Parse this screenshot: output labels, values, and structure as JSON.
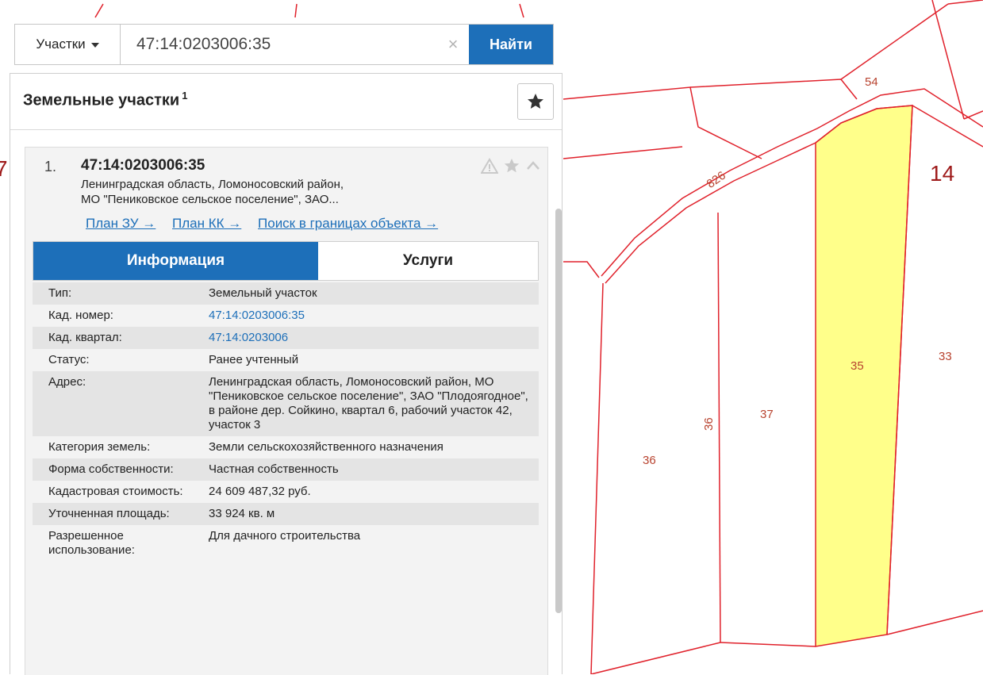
{
  "search": {
    "type_label": "Участки",
    "query": "47:14:0203006:35",
    "clear_glyph": "×",
    "find_label": "Найти"
  },
  "panel": {
    "title": "Земельные участки",
    "count": "1",
    "favorite_icon": "star-icon"
  },
  "result": {
    "index": "1.",
    "cad_number": "47:14:0203006:35",
    "address_short_line1": "Ленинградская область, Ломоносовский район,",
    "address_short_line2": "МО \"Пениковское сельское поселение\", ЗАО...",
    "tools": [
      "warning-icon",
      "star-icon",
      "chevron-up-icon"
    ],
    "links": {
      "plan_zu": "План ЗУ →",
      "plan_kk": "План КК →",
      "search_in_bounds": "Поиск в границах объекта →"
    },
    "tabs": {
      "info": "Информация",
      "services": "Услуги"
    },
    "info": [
      {
        "key": "Тип:",
        "value": "Земельный участок"
      },
      {
        "key": "Кад. номер:",
        "value": "47:14:0203006:35",
        "link": true
      },
      {
        "key": "Кад. квартал:",
        "value": "47:14:0203006",
        "link": true
      },
      {
        "key": "Статус:",
        "value": "Ранее учтенный"
      },
      {
        "key": "Адрес:",
        "value": "Ленинградская область, Ломоносовский район, МО \"Пениковское сельское поселение\", ЗАО \"Плодоягодное\", в районе дер. Сойкино, квартал 6, рабочий участок 42, участок 3"
      },
      {
        "key": "Категория земель:",
        "value": "Земли сельскохозяйственного назначения"
      },
      {
        "key": "Форма собственности:",
        "value": "Частная собственность"
      },
      {
        "key": "Кадастровая стоимость:",
        "value": "24 609 487,32 руб."
      },
      {
        "key": "Уточненная площадь:",
        "value": "33 924 кв. м"
      },
      {
        "key": "Разрешенное использование:",
        "value": "Для дачного строительства"
      }
    ]
  },
  "map": {
    "line_color": "#e0212b",
    "highlight_color": "#ffff8a",
    "labels": {
      "plot_54": "54",
      "road_826": "826",
      "quarter_14": "14",
      "plot_35": "35",
      "plot_33": "33",
      "plot_37": "37",
      "plot_36_vertical": "36",
      "plot_36": "36",
      "edge_7": "7"
    }
  }
}
